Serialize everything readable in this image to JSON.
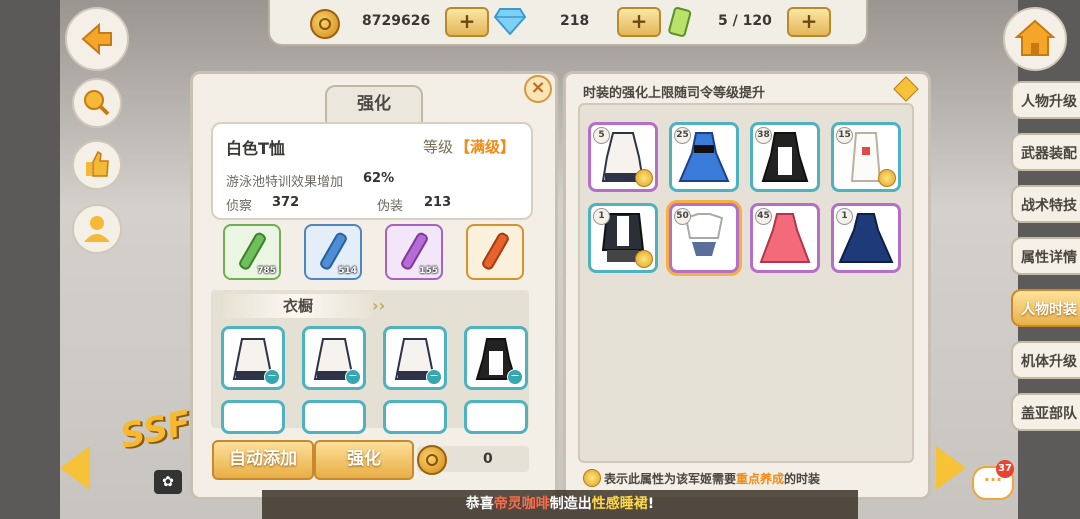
{
  "resources": {
    "coins": "8729626",
    "diamonds": "218",
    "stamina": "5 / 120",
    "plus": "+"
  },
  "left_panel": {
    "tab_label": "强化",
    "item_name": "白色T恤",
    "level_label": "等级",
    "level_value": "【满级】",
    "effect_label": "游泳池特训效果增加",
    "effect_value": "62%",
    "stat1_label": "侦察",
    "stat1_value": "372",
    "stat2_label": "伪装",
    "stat2_value": "213",
    "potions": [
      {
        "count": "785",
        "color": "#6fbf5a"
      },
      {
        "count": "514",
        "color": "#4d8fd6"
      },
      {
        "count": "155",
        "color": "#b86ad6"
      },
      {
        "count": "",
        "color": "#e8632b"
      }
    ],
    "wardrobe_label": "衣橱",
    "auto_add_label": "自动添加",
    "enhance_label": "强化",
    "cost_value": "0"
  },
  "right_panel": {
    "title": "时装的强化上限随司令等级提升",
    "items": [
      {
        "level": "5",
        "border": "#b470c8"
      },
      {
        "level": "25",
        "border": "#4fb3bf"
      },
      {
        "level": "38",
        "border": "#4fb3bf"
      },
      {
        "level": "15",
        "border": "#4fb3bf"
      },
      {
        "level": "1",
        "border": "#4fb3bf"
      },
      {
        "level": "50",
        "border": "#b470c8"
      },
      {
        "level": "45",
        "border": "#b470c8"
      },
      {
        "level": "1",
        "border": "#b470c8"
      }
    ],
    "footer_prefix": "表示此属性为该军姬需要",
    "footer_highlight": "重点养成",
    "footer_suffix": "的时装"
  },
  "side_tabs": [
    "人物升级",
    "武器装配",
    "战术特技",
    "属性详情",
    "人物时装",
    "机体升级",
    "盖亚部队"
  ],
  "active_tab": "人物时装",
  "notice": {
    "prefix": "恭喜",
    "name": "帝灵咖啡",
    "middle": "制造出",
    "item": "性感睡裙",
    "suffix": "!"
  },
  "chat_count": "37",
  "ssr_label": "SSF"
}
